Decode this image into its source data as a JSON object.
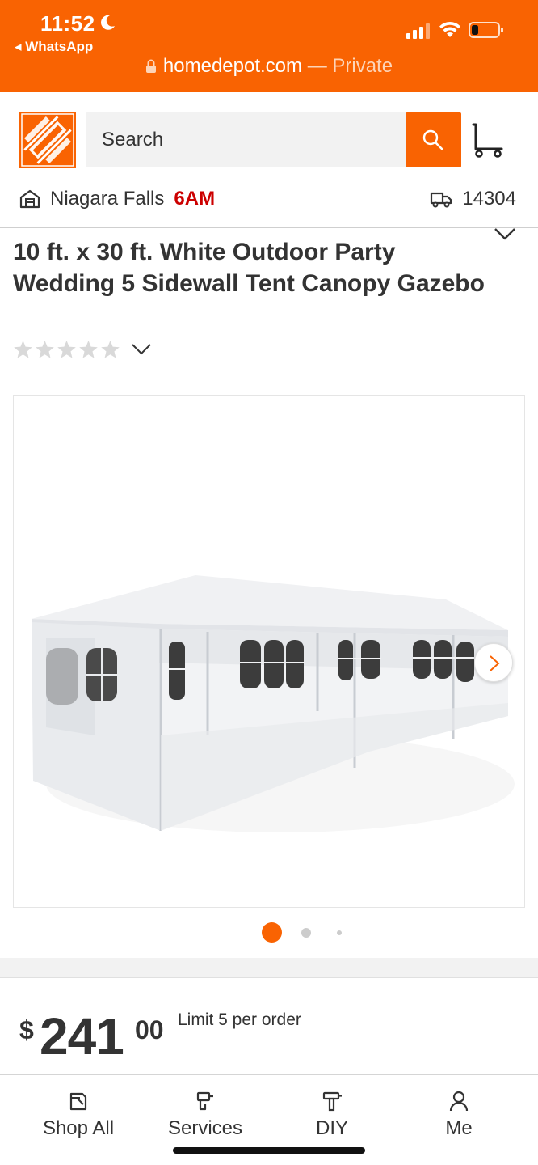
{
  "status_bar": {
    "time": "11:52",
    "back_app": "◂ WhatsApp",
    "url": "homedepot.com",
    "private_label": "— Private"
  },
  "header": {
    "search_placeholder": "Search",
    "store_name": "Niagara Falls",
    "store_time": "6AM",
    "zip": "14304"
  },
  "product": {
    "title": "10 ft. x 30 ft. White Outdoor Party Wedding 5 Sidewall Tent Canopy Gazebo",
    "rating_stars": 0,
    "image_count": 3,
    "active_image": 1
  },
  "price": {
    "currency": "$",
    "dollars": "241",
    "cents": "00",
    "limit_text": "Limit 5 per order"
  },
  "bottom_nav": [
    {
      "label": "Shop All",
      "icon": "shop-all-icon"
    },
    {
      "label": "Services",
      "icon": "services-icon"
    },
    {
      "label": "DIY",
      "icon": "diy-icon"
    },
    {
      "label": "Me",
      "icon": "user-icon"
    }
  ],
  "colors": {
    "brand_orange": "#f96302",
    "store_time_red": "#cc0000",
    "text": "#333333"
  }
}
